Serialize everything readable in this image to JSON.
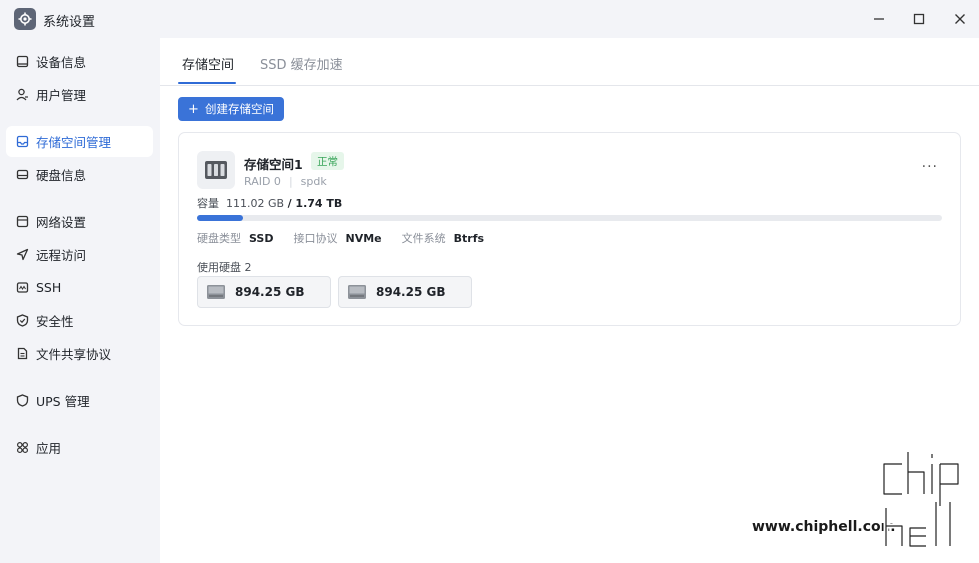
{
  "window": {
    "title": "系统设置",
    "app_icon": "gear-icon",
    "controls": [
      "minimize",
      "maximize",
      "close"
    ]
  },
  "sidebar": {
    "items": [
      {
        "label": "设备信息",
        "icon": "monitor-icon",
        "active": false
      },
      {
        "label": "用户管理",
        "icon": "user-icon",
        "active": false
      },
      {
        "label": "存储空间管理",
        "icon": "storage-icon",
        "active": true
      },
      {
        "label": "硬盘信息",
        "icon": "disk-icon",
        "active": false
      },
      {
        "label": "网络设置",
        "icon": "network-icon",
        "active": false
      },
      {
        "label": "远程访问",
        "icon": "send-icon",
        "active": false
      },
      {
        "label": "SSH",
        "icon": "terminal-icon",
        "active": false
      },
      {
        "label": "安全性",
        "icon": "shield-check-icon",
        "active": false
      },
      {
        "label": "文件共享协议",
        "icon": "file-icon",
        "active": false
      },
      {
        "label": "UPS 管理",
        "icon": "shield-icon",
        "active": false
      },
      {
        "label": "应用",
        "icon": "apps-icon",
        "active": false
      }
    ]
  },
  "tabs": [
    {
      "label": "存储空间",
      "active": true
    },
    {
      "label": "SSD 缓存加速",
      "active": false
    }
  ],
  "create_button": {
    "label": "创建存储空间"
  },
  "pool": {
    "name": "存储空间1",
    "status": "正常",
    "raid": "RAID 0",
    "engine": "spdk",
    "capacity_label": "容量",
    "used": "111.02 GB",
    "total": "1.74 TB",
    "used_fraction": 0.062,
    "disk_type_label": "硬盘类型",
    "disk_type": "SSD",
    "interface_label": "接口协议",
    "interface": "NVMe",
    "filesystem_label": "文件系统",
    "filesystem": "Btrfs",
    "disks_label": "使用硬盘 2",
    "disks": [
      {
        "size": "894.25 GB"
      },
      {
        "size": "894.25 GB"
      }
    ]
  },
  "watermark": {
    "text": "www.chiphell.com"
  },
  "colors": {
    "accent": "#3a73d8",
    "status_ok": "#3aa55b",
    "status_ok_bg": "#e6f6ea"
  }
}
